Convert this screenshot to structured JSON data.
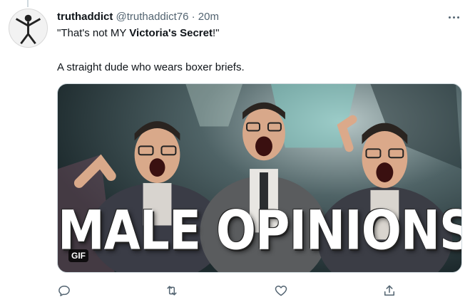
{
  "tweet": {
    "display_name": "truthaddict",
    "handle": "@truthaddict76",
    "separator": "·",
    "time": "20m",
    "text_line1_pre": "\"That's not MY ",
    "text_line1_bold": "Victoria's Secret",
    "text_line1_post": "!\"",
    "text_line2": "A straight dude who wears boxer briefs."
  },
  "media": {
    "overlay_text": "MALE OPINIONS",
    "badge": "GIF"
  },
  "actions": {
    "icons": [
      "reply-icon",
      "retweet-icon",
      "like-icon",
      "share-icon"
    ]
  },
  "colors": {
    "text_primary": "#0f1419",
    "text_secondary": "#536471",
    "icon": "#536471",
    "border": "#cfd9de"
  }
}
